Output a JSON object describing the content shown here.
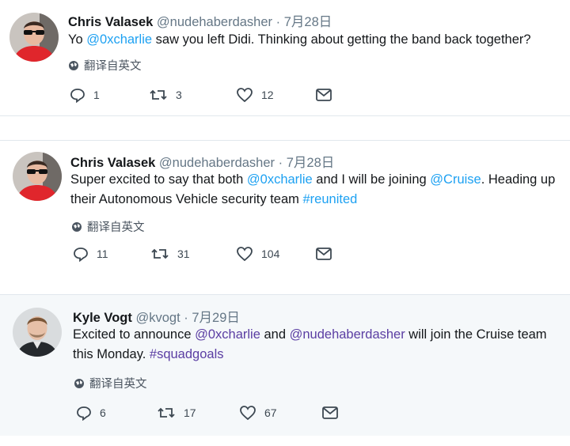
{
  "tweets": [
    {
      "author": "Chris Valasek",
      "handle": "@nudehaberdasher",
      "dot": "·",
      "date": "7月28日",
      "text_parts": [
        "Yo ",
        "@0xcharlie",
        " saw you left Didi. Thinking about getting the band back together?"
      ],
      "translate": "翻译自英文",
      "replies": "1",
      "retweets": "3",
      "likes": "12"
    },
    {
      "author": "Chris Valasek",
      "handle": "@nudehaberdasher",
      "dot": "·",
      "date": "7月28日",
      "text_parts": [
        "Super excited to say that both ",
        "@0xcharlie",
        " and I will be joining ",
        "@Cruise",
        ". Heading up their Autonomous Vehicle security team ",
        "#reunited"
      ],
      "translate": "翻译自英文",
      "replies": "11",
      "retweets": "31",
      "likes": "104"
    },
    {
      "author": "Kyle Vogt",
      "handle": "@kvogt",
      "dot": "·",
      "date": "7月29日",
      "text_parts": [
        "Excited to announce ",
        "@0xcharlie",
        " and ",
        "@nudehaberdasher",
        " will join the Cruise team this Monday. ",
        "#squadgoals"
      ],
      "translate": "翻译自英文",
      "replies": "6",
      "retweets": "17",
      "likes": "67"
    }
  ],
  "icons": {
    "reply": "reply-icon",
    "retweet": "retweet-icon",
    "like": "heart-icon",
    "message": "envelope-icon",
    "globe": "globe-icon"
  },
  "colors": {
    "link": "#1da1f2",
    "link_highlighted": "#5b3ea3",
    "highlight_bg": "#f5f8fa",
    "divider": "#e1e8ed",
    "muted": "#657786"
  }
}
